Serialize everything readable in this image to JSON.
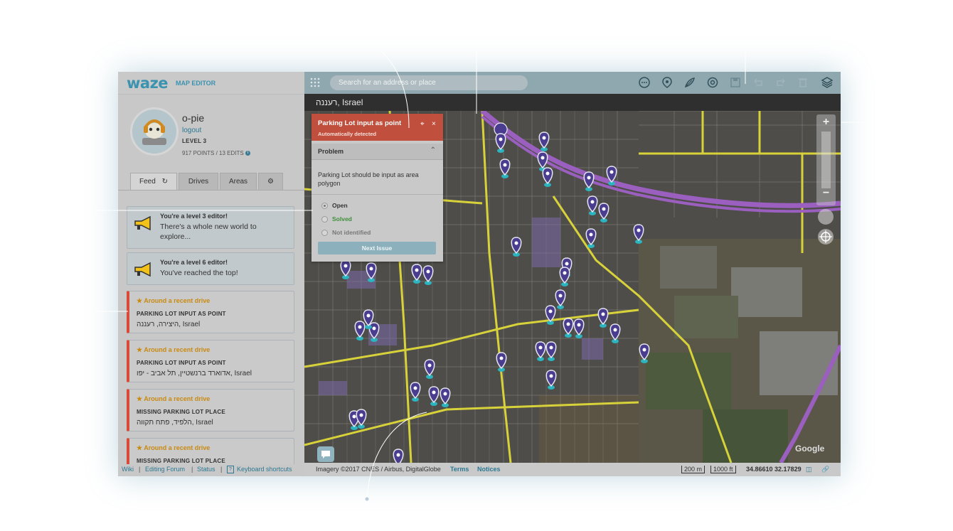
{
  "brand": {
    "logo": "waze",
    "subtitle": "MAP EDITOR"
  },
  "user": {
    "name": "o-pie",
    "logout": "logout",
    "level": "LEVEL 3",
    "points": "917 POINTS  /  13 EDITS"
  },
  "tabs": [
    {
      "label": "Feed"
    },
    {
      "label": "Drives"
    },
    {
      "label": "Areas"
    }
  ],
  "feed": {
    "promos": [
      {
        "title": "You're a level 3 editor!",
        "text": "There's a whole new world to explore..."
      },
      {
        "title": "You're a level 6 editor!",
        "text": "You've reached the top!"
      }
    ],
    "issues": [
      {
        "hint": "★ Around a recent drive",
        "type": "PARKING LOT INPUT AS POINT",
        "location": "היצירה, רעננה, Israel"
      },
      {
        "hint": "★ Around a recent drive",
        "type": "PARKING LOT INPUT AS POINT",
        "location": "אדוארד ברנשטיין, תל אביב - יפו, Israel"
      },
      {
        "hint": "★ Around a recent drive",
        "type": "MISSING PARKING LOT PLACE",
        "location": "הלפיד, פתח תקווה, Israel"
      },
      {
        "hint": "★ Around a recent drive",
        "type": "MISSING PARKING LOT PLACE",
        "location": ""
      }
    ]
  },
  "footer": {
    "wiki": "Wiki",
    "forum": "Editing Forum",
    "status": "Status",
    "shortcuts": "Keyboard shortcuts"
  },
  "search": {
    "placeholder": "Search for an address or place"
  },
  "breadcrumb": "רעננה, Israel",
  "panel": {
    "title": "Parking Lot input as point",
    "subtitle": "Automatically detected",
    "section": "Problem",
    "description": "Parking Lot should be input as area polygon",
    "options": [
      "Open",
      "Solved",
      "Not identified"
    ],
    "next": "Next Issue"
  },
  "mapfooter": {
    "imagery": "Imagery ©2017 CNES / Airbus, DigitalGlobe",
    "terms": "Terms",
    "notices": "Notices",
    "scale_m": "200 m",
    "scale_ft": "1000 ft",
    "coords": "34.86610 32.17829"
  },
  "map_labels": {
    "google": "Google"
  },
  "colors": {
    "accent": "#3b93b0",
    "issue_red": "#c0503d",
    "highway": "#9b5fc0",
    "road": "#d7d23a",
    "pin": "#4a3d8f",
    "pin_base": "#2cb5c0"
  }
}
